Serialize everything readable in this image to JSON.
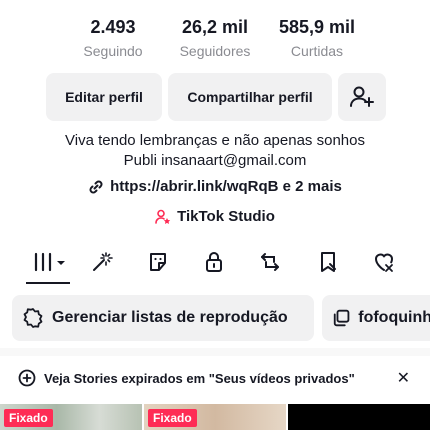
{
  "stats": [
    {
      "value": "2.493",
      "label": "Seguindo"
    },
    {
      "value": "26,2 mil",
      "label": "Seguidores"
    },
    {
      "value": "585,9 mil",
      "label": "Curtidas"
    }
  ],
  "actions": {
    "edit_label": "Editar perfil",
    "share_label": "Compartilhar perfil",
    "add_friend_icon": "add-person-icon"
  },
  "bio": {
    "line1": "Viva tendo lembranças e não apenas sonhos",
    "line2": "Publi insanaart@gmail.com"
  },
  "link": {
    "text": "https://abrir.link/wqRqB e 2 mais",
    "icon": "link-icon"
  },
  "studio": {
    "label": "TikTok Studio",
    "icon": "person-star-icon",
    "icon_color": "#fe2c55"
  },
  "tabs": [
    {
      "name": "videos",
      "icon": "grid-icon",
      "active": true
    },
    {
      "name": "effects",
      "icon": "magic-wand-icon"
    },
    {
      "name": "stickers",
      "icon": "sticker-icon"
    },
    {
      "name": "private",
      "icon": "lock-icon"
    },
    {
      "name": "reposts",
      "icon": "repost-icon"
    },
    {
      "name": "favorites",
      "icon": "bookmark-icon"
    },
    {
      "name": "liked",
      "icon": "heart-icon"
    }
  ],
  "chips": {
    "playlists_label": "Gerenciar listas de reprodução",
    "playlist_name": "fofoquinh"
  },
  "notice": {
    "text": "Veja Stories expirados em \"Seus vídeos privados\"",
    "close": "✕"
  },
  "thumbnails": [
    {
      "badge": "Fixado"
    },
    {
      "badge": "Fixado"
    },
    {
      "badge": ""
    }
  ],
  "colors": {
    "accent": "#fe2c55",
    "text": "#161823",
    "muted": "#8a8b91",
    "button_bg": "#f1f1f2"
  }
}
